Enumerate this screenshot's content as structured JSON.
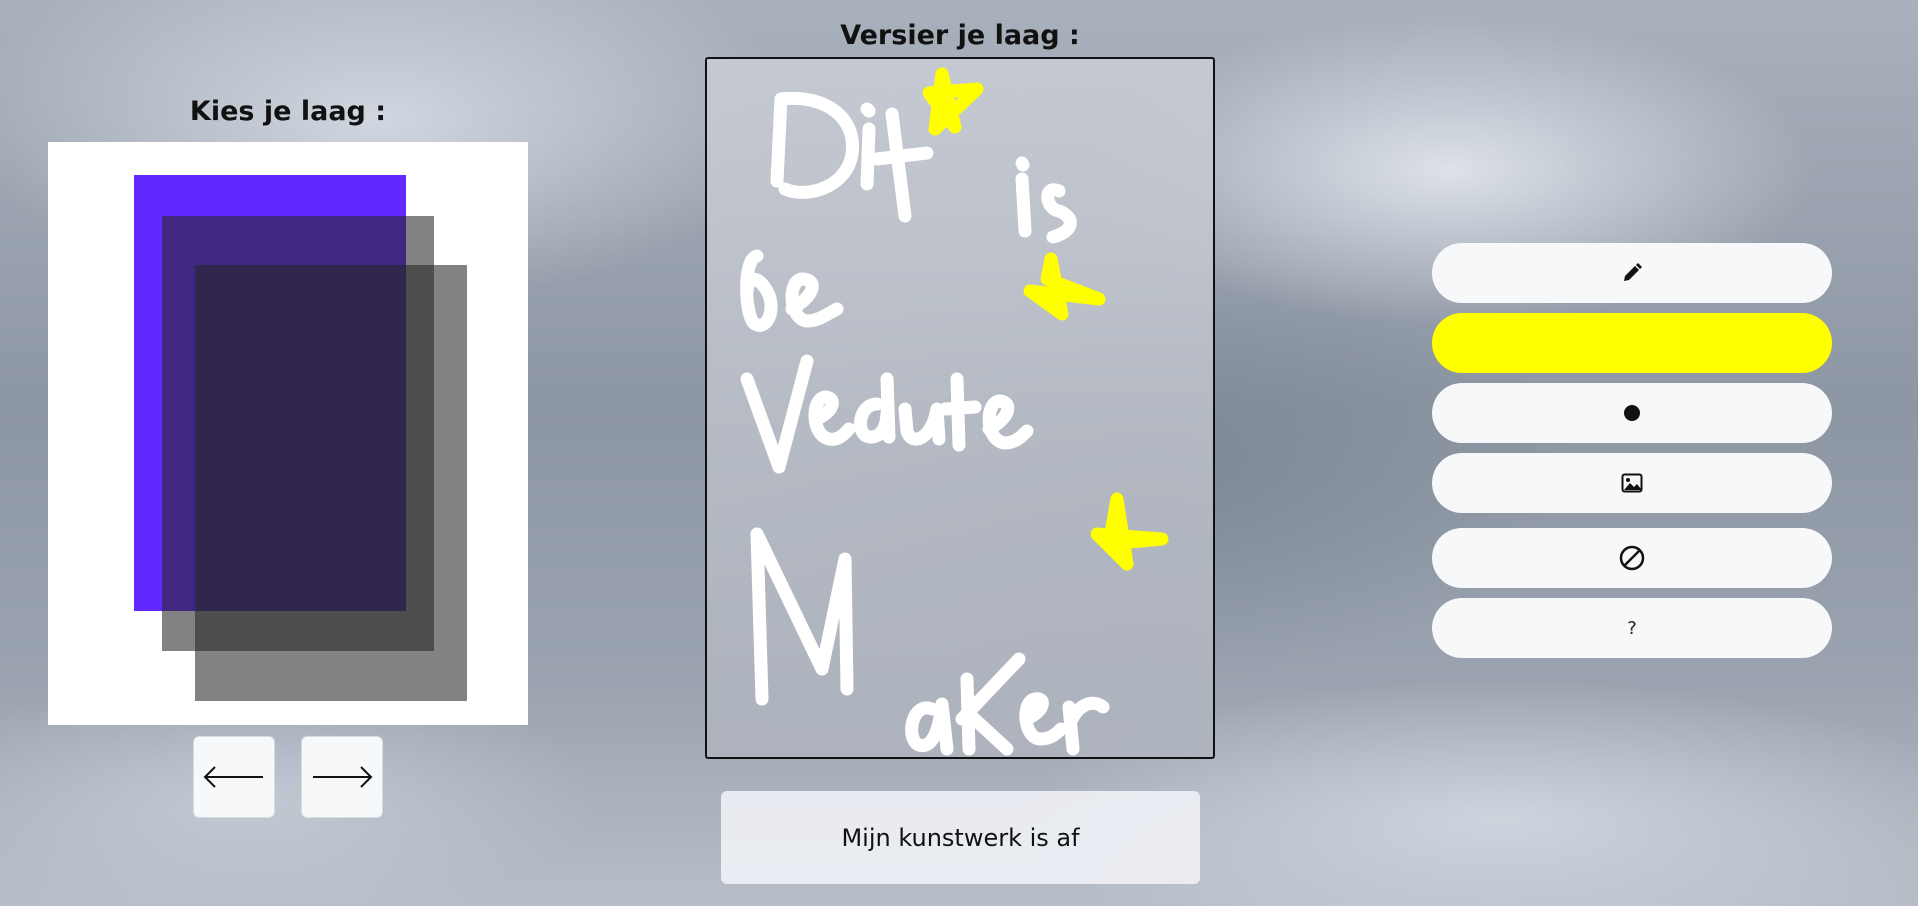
{
  "left_panel": {
    "title": "Kies je laag :",
    "layers": [
      {
        "name": "layer-1",
        "color": "#6128ff"
      },
      {
        "name": "layer-2",
        "color": "#282828"
      },
      {
        "name": "layer-3",
        "color": "#282828"
      }
    ],
    "prev_icon": "arrow-left-icon",
    "next_icon": "arrow-right-icon"
  },
  "center_panel": {
    "title": "Versier je laag :",
    "drawing_stroke_color": "#ffffff",
    "star_color": "#ffff00",
    "finish_label": "Mijn kunstwerk is af"
  },
  "tools": {
    "pencil_icon": "pencil-icon",
    "current_color": "#ffff00",
    "size_icon": "dot-icon",
    "image_icon": "image-icon",
    "clear_icon": "ban-icon",
    "help_label": "?"
  }
}
